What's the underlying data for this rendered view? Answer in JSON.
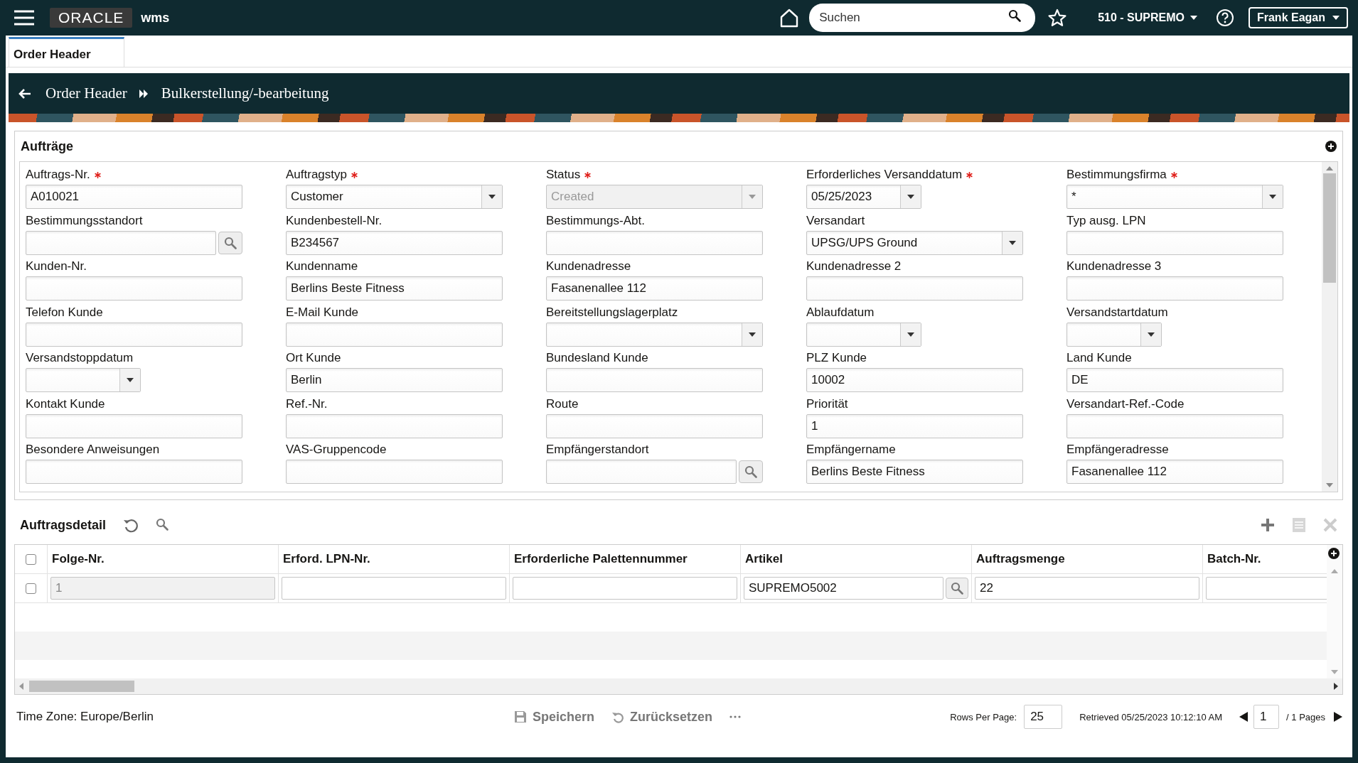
{
  "topbar": {
    "logo": "ORACLE",
    "app": "wms",
    "search": {
      "placeholder": "Suchen"
    },
    "facility": "510 - SUPREMO",
    "user": "Frank Eagan"
  },
  "tabs": [
    {
      "label": "Order Header",
      "selected": true
    }
  ],
  "breadcrumb": [
    "Order Header",
    "Bulkerstellung/-bearbeitung"
  ],
  "orders_panel": {
    "title": "Aufträge",
    "fields": [
      {
        "label": "Auftrags-Nr.",
        "required": true,
        "kind": "text",
        "value": "A010021",
        "disabled": false
      },
      {
        "label": "Auftragstyp",
        "required": true,
        "kind": "select",
        "value": "Customer",
        "disabled": false
      },
      {
        "label": "Status",
        "required": true,
        "kind": "select",
        "value": "Created",
        "disabled": true
      },
      {
        "label": "Erforderliches Versanddatum",
        "required": true,
        "kind": "date",
        "value": "05/25/2023",
        "disabled": false
      },
      {
        "label": "Bestimmungsfirma",
        "required": true,
        "kind": "select",
        "value": "*",
        "disabled": false
      },
      {
        "label": "Bestimmungsstandort",
        "required": false,
        "kind": "lookup",
        "disabled": false
      },
      {
        "label": "Kundenbestell-Nr.",
        "required": false,
        "kind": "text",
        "value": "B234567",
        "disabled": false
      },
      {
        "label": "Bestimmungs-Abt.",
        "required": false,
        "kind": "text",
        "disabled": false
      },
      {
        "label": "Versandart",
        "required": false,
        "kind": "select",
        "value": "UPSG/UPS Ground",
        "disabled": false
      },
      {
        "label": "Typ ausg. LPN",
        "required": false,
        "kind": "text",
        "disabled": false
      },
      {
        "label": "Kunden-Nr.",
        "required": false,
        "kind": "text",
        "disabled": false
      },
      {
        "label": "Kundenname",
        "required": false,
        "kind": "text",
        "value": "Berlins Beste Fitness",
        "disabled": false
      },
      {
        "label": "Kundenadresse",
        "required": false,
        "kind": "text",
        "value": "Fasanenallee 112",
        "disabled": false
      },
      {
        "label": "Kundenadresse 2",
        "required": false,
        "kind": "text",
        "disabled": false
      },
      {
        "label": "Kundenadresse 3",
        "required": false,
        "kind": "text",
        "disabled": false
      },
      {
        "label": "Telefon Kunde",
        "required": false,
        "kind": "text",
        "disabled": false
      },
      {
        "label": "E-Mail Kunde",
        "required": false,
        "kind": "text",
        "disabled": false
      },
      {
        "label": "Bereitstellungslagerplatz",
        "required": false,
        "kind": "select",
        "disabled": false
      },
      {
        "label": "Ablaufdatum",
        "required": false,
        "kind": "date",
        "disabled": false
      },
      {
        "label": "Versandstartdatum",
        "required": false,
        "kind": "date",
        "disabled": false
      },
      {
        "label": "Versandstoppdatum",
        "required": false,
        "kind": "date",
        "disabled": false
      },
      {
        "label": "Ort Kunde",
        "required": false,
        "kind": "text",
        "value": "Berlin",
        "disabled": false
      },
      {
        "label": "Bundesland Kunde",
        "required": false,
        "kind": "text",
        "disabled": false
      },
      {
        "label": "PLZ Kunde",
        "required": false,
        "kind": "text",
        "value": "10002",
        "disabled": false
      },
      {
        "label": "Land Kunde",
        "required": false,
        "kind": "text",
        "value": "DE",
        "disabled": false
      },
      {
        "label": "Kontakt Kunde",
        "required": false,
        "kind": "text",
        "disabled": false
      },
      {
        "label": "Ref.-Nr.",
        "required": false,
        "kind": "text",
        "disabled": false
      },
      {
        "label": "Route",
        "required": false,
        "kind": "text",
        "disabled": false
      },
      {
        "label": "Priorität",
        "required": false,
        "kind": "text",
        "value": "1",
        "disabled": false
      },
      {
        "label": "Versandart-Ref.-Code",
        "required": false,
        "kind": "text",
        "disabled": false
      },
      {
        "label": "Besondere Anweisungen",
        "required": false,
        "kind": "text",
        "disabled": false
      },
      {
        "label": "VAS-Gruppencode",
        "required": false,
        "kind": "text",
        "disabled": false
      },
      {
        "label": "Empfängerstandort",
        "required": false,
        "kind": "lookup",
        "disabled": false
      },
      {
        "label": "Empfängername",
        "required": false,
        "kind": "text",
        "value": "Berlins Beste Fitness",
        "disabled": false
      },
      {
        "label": "Empfängeradresse",
        "required": false,
        "kind": "text",
        "value": "Fasanenallee 112",
        "disabled": false
      }
    ]
  },
  "detail_panel": {
    "title": "Auftragsdetail",
    "header_checked": false,
    "columns": [
      "Folge-Nr.",
      "Erford. LPN-Nr.",
      "Erforderliche Palettennummer",
      "Artikel",
      "Auftragsmenge",
      "Batch-Nr."
    ],
    "rows": [
      {
        "checked": false,
        "cells": [
          {
            "kind": "readonly",
            "value": "1"
          },
          {
            "kind": "text"
          },
          {
            "kind": "text"
          },
          {
            "kind": "lookup",
            "value": "SUPREMO5002"
          },
          {
            "kind": "text",
            "value": "22"
          },
          {
            "kind": "text"
          }
        ]
      }
    ]
  },
  "footer": {
    "time_zone": "Time Zone: Europe/Berlin",
    "actions": [
      {
        "label": "Speichern",
        "kind": "save",
        "disabled": true
      },
      {
        "label": "Zurücksetzen",
        "kind": "reset",
        "disabled": true
      }
    ],
    "rows_per_page_label": "Rows Per Page:",
    "rows_per_page": "25",
    "retrieved": "Retrieved 05/25/2023 10:12:10 AM",
    "page": "1",
    "pages": "/ 1 Pages"
  }
}
